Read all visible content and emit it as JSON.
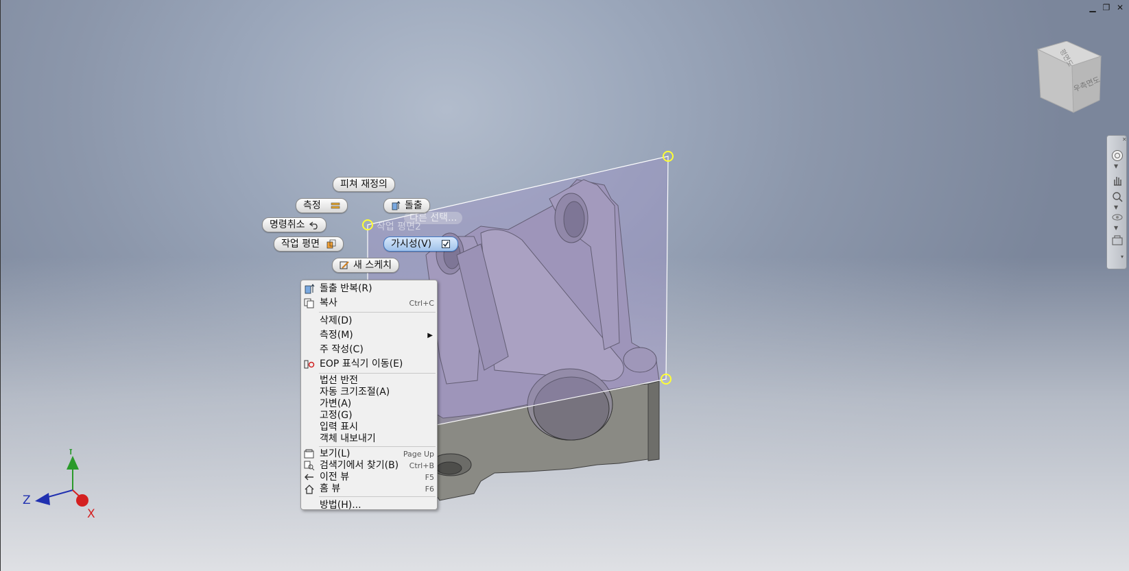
{
  "window_controls": {
    "minimize": "▁",
    "restore": "❐",
    "close": "✕"
  },
  "mini_toolbar": {
    "redefine_feature": "피쳐 재정의",
    "measure": "측정",
    "extrude": "돌출",
    "undo": "명령취소",
    "other_select": "다른 선택...",
    "work_plane": "작업 평면",
    "visibility": "가시성(V)",
    "new_sketch": "새 스케치"
  },
  "plane_label": "작업 평면2",
  "context_menu": {
    "items": [
      {
        "label": "돌출 반복(R)",
        "shortcut": ""
      },
      {
        "label": "복사",
        "shortcut": "Ctrl+C"
      },
      {
        "label": "삭제(D)",
        "shortcut": ""
      },
      {
        "label": "측정(M)",
        "shortcut": ""
      },
      {
        "label": "주 작성(C)",
        "shortcut": ""
      },
      {
        "label": "EOP 표식기 이동(E)",
        "shortcut": ""
      },
      {
        "label": "법선 반전",
        "shortcut": ""
      },
      {
        "label": "자동 크기조절(A)",
        "shortcut": ""
      },
      {
        "label": "가변(A)",
        "shortcut": ""
      },
      {
        "label": "고정(G)",
        "shortcut": ""
      },
      {
        "label": "입력 표시",
        "shortcut": ""
      },
      {
        "label": "객체 내보내기",
        "shortcut": ""
      },
      {
        "label": "보기(L)",
        "shortcut": "Page Up"
      },
      {
        "label": "검색기에서 찾기(B)",
        "shortcut": "Ctrl+B"
      },
      {
        "label": "이전 뷰",
        "shortcut": "F5"
      },
      {
        "label": "홈 뷰",
        "shortcut": "F6"
      },
      {
        "label": "방법(H)...",
        "shortcut": ""
      }
    ]
  },
  "view_cube": {
    "top_face": "평면도",
    "right_face": "우측면도"
  },
  "triad": {
    "x": "X",
    "y": "Y",
    "z": "Z"
  },
  "colors": {
    "plane_fill": "#9a8fc4",
    "part_shade": "#9f99a6",
    "handle": "#ffff33",
    "axis_x": "#d42020",
    "axis_y": "#2a9a2a",
    "axis_z": "#2030b0"
  },
  "icons": [
    "extrude-icon",
    "copy-icon",
    "eop-icon",
    "view-icon",
    "find-icon",
    "previous-view-icon",
    "home-icon",
    "measure-icon",
    "undo-icon",
    "work-plane-icon",
    "sketch-icon",
    "visibility-checkbox-icon"
  ]
}
